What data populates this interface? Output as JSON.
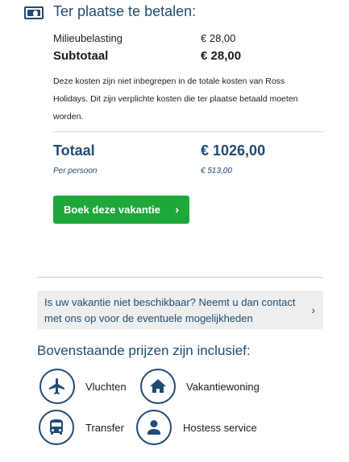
{
  "local_costs": {
    "icon": "money-icon",
    "title": "Ter plaatse te betalen:",
    "items": [
      {
        "label": "Milieubelasting",
        "value": "€ 28,00"
      }
    ],
    "subtotal_label": "Subtotaal",
    "subtotal_value": "€ 28,00",
    "note": "Deze kosten zijn niet inbegrepen in de totale kosten van Ross Holidays. Dit zijn verplichte kosten die ter plaatse betaald moeten worden."
  },
  "total": {
    "label": "Totaal",
    "value": "€ 1026,00",
    "per_person_label": "Per persoon",
    "per_person_value": "€ 513,00"
  },
  "book_button": {
    "label": "Boek deze vakantie",
    "icon": "chevron-right-icon",
    "color": "#1fa83a"
  },
  "unavailable_box": {
    "text": "Is uw vakantie niet beschikbaar? Neemt u dan contact met ons op voor de eventuele mogelijkheden",
    "icon": "chevron-right-icon"
  },
  "inclusions": {
    "title": "Bovenstaande prijzen zijn inclusief:",
    "items": [
      {
        "label": "Vluchten",
        "icon": "airplane-icon"
      },
      {
        "label": "Vakantiewoning",
        "icon": "house-icon"
      },
      {
        "label": "Transfer",
        "icon": "bus-icon"
      },
      {
        "label": "Hostess service",
        "icon": "person-icon"
      }
    ]
  },
  "colors": {
    "brand_blue": "#1f4b74",
    "accent_green": "#1fa83a",
    "box_grey": "#eeeeee"
  }
}
